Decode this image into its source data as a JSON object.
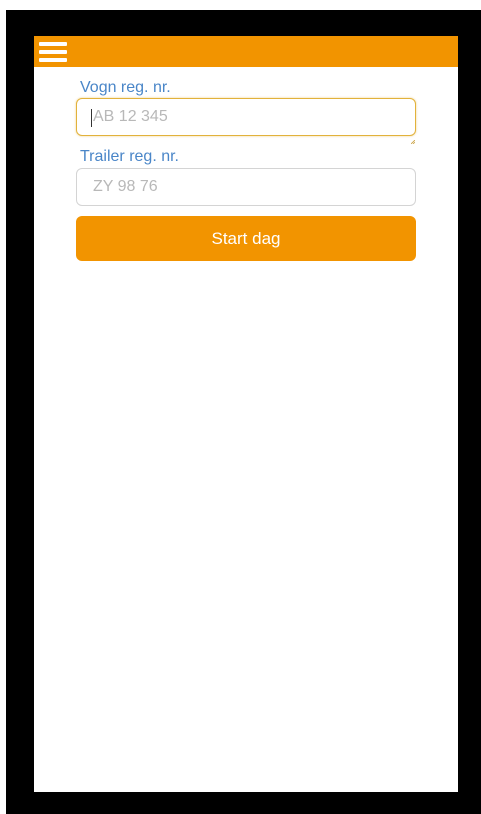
{
  "app_bar": {
    "menu_icon": "hamburger-menu-icon",
    "color": "#f29400"
  },
  "form": {
    "vogn": {
      "label": "Vogn reg. nr.",
      "placeholder": "AB 12 345",
      "value": ""
    },
    "trailer": {
      "label": "Trailer reg. nr.",
      "placeholder": "ZY 98 76",
      "value": ""
    },
    "start_button": {
      "label": "Start dag"
    }
  },
  "colors": {
    "accent": "#f29400",
    "label": "#4a86c8",
    "focus_border": "#e2b23c",
    "placeholder": "#b8b8b8"
  }
}
